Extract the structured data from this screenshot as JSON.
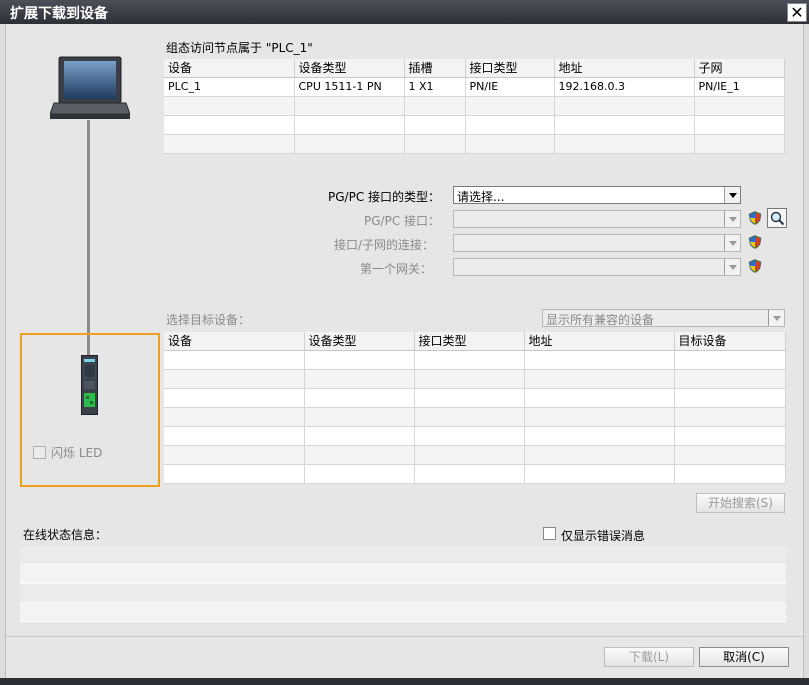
{
  "window": {
    "title": "扩展下载到设备",
    "close_glyph": "✕"
  },
  "config_section": {
    "heading": "组态访问节点属于 \"PLC_1\"",
    "columns": [
      "设备",
      "设备类型",
      "插槽",
      "接口类型",
      "地址",
      "子网"
    ],
    "rows": [
      [
        "PLC_1",
        "CPU 1511-1 PN",
        "1 X1",
        "PN/IE",
        "192.168.0.3",
        "PN/IE_1"
      ],
      [
        "",
        "",
        "",
        "",
        "",
        ""
      ],
      [
        "",
        "",
        "",
        "",
        "",
        ""
      ],
      [
        "",
        "",
        "",
        "",
        "",
        ""
      ]
    ]
  },
  "interface": {
    "type_label": "PG/PC 接口的类型：",
    "type_value": "请选择...",
    "pgpc_label": "PG/PC 接口：",
    "subnet_label": "接口/子网的连接：",
    "gateway_label": "第一个网关："
  },
  "target_section": {
    "label": "选择目标设备：",
    "filter_value": "显示所有兼容的设备",
    "columns": [
      "设备",
      "设备类型",
      "接口类型",
      "地址",
      "目标设备"
    ],
    "rows": [
      [
        "",
        "",
        "",
        "",
        ""
      ],
      [
        "",
        "",
        "",
        "",
        ""
      ],
      [
        "",
        "",
        "",
        "",
        ""
      ],
      [
        "",
        "",
        "",
        "",
        ""
      ],
      [
        "",
        "",
        "",
        "",
        ""
      ],
      [
        "",
        "",
        "",
        "",
        ""
      ],
      [
        "",
        "",
        "",
        "",
        ""
      ]
    ]
  },
  "flash_led_label": "闪烁 LED",
  "start_search_label": "开始搜索(S)",
  "status": {
    "label": "在线状态信息：",
    "only_errors_label": "仅显示错误消息"
  },
  "footer": {
    "download_label": "下载(L)",
    "cancel_label": "取消(C)"
  },
  "icons": [
    "laptop-icon",
    "plc-device-icon",
    "shield-icon",
    "magnify-icon",
    "close-icon",
    "dropdown-arrow-icon"
  ],
  "colors": {
    "highlight": "#f0a020",
    "titlebar": "#2c2f36",
    "plc_green": "#2fb84b"
  }
}
